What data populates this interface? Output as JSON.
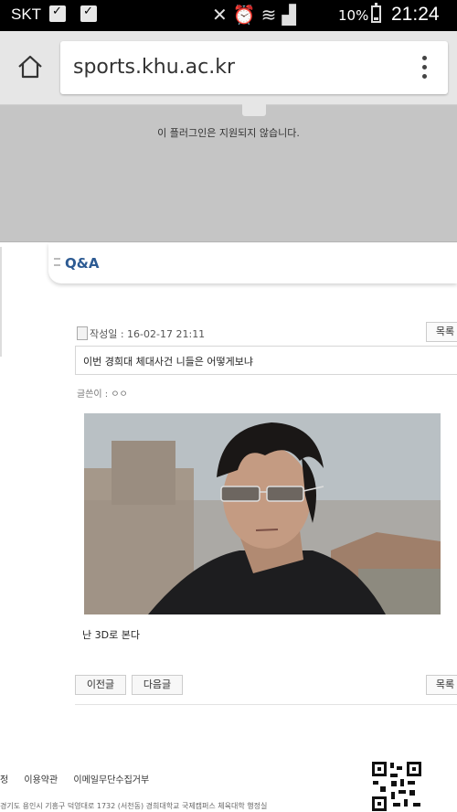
{
  "status_bar": {
    "carrier": "SKT",
    "battery": "10%",
    "time": "21:24"
  },
  "browser": {
    "url": "sports.khu.ac.kr"
  },
  "plugin": {
    "message": "이 플러그인은 지원되지 않습니다."
  },
  "section": {
    "title": "Q&A"
  },
  "post": {
    "date": "작성일 : 16-02-17 21:11",
    "list_label": "목록",
    "title": "이번 경희대 체대사건 니들은 어떻게보냐",
    "author": "글쓴이 : ㅇㅇ",
    "body": "난 3D로 본다",
    "prev_label": "이전글",
    "next_label": "다음글"
  },
  "footer": {
    "links": [
      "정",
      "이용약관",
      "이메일무단수집거부"
    ],
    "address": "경기도 용인시 기흥구 덕영대로 1732 (서천동) 경희대학교 국제캠퍼스 체육대학 행정실"
  }
}
